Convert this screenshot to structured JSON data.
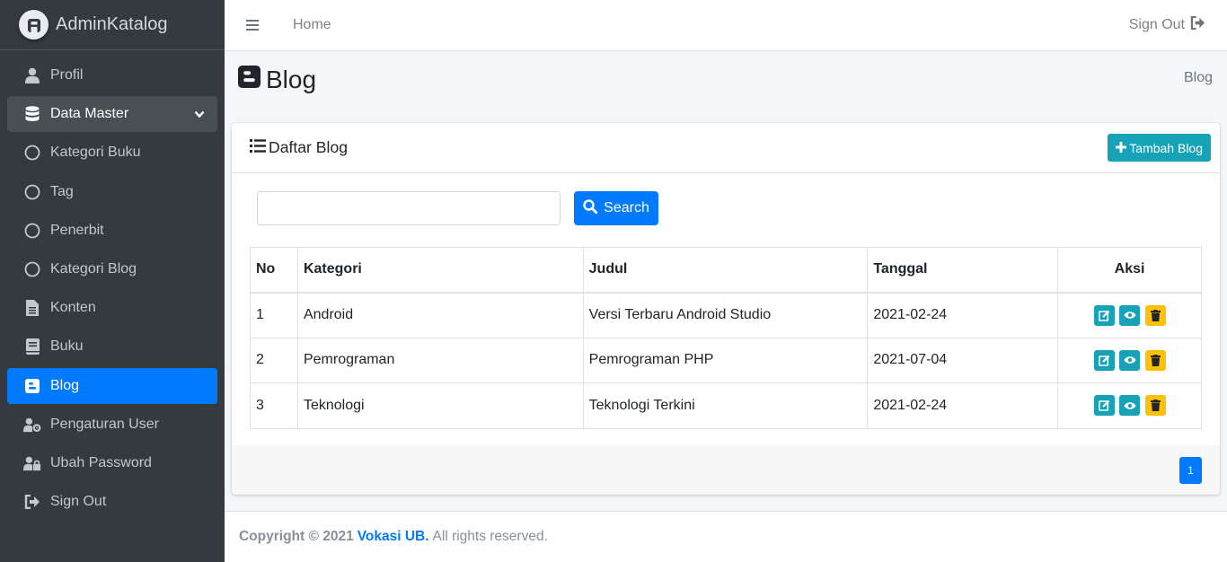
{
  "brand": {
    "name": "AdminKatalog",
    "logo_icon": "brand-logo-icon"
  },
  "sidebar": {
    "items": [
      {
        "label": "Profil",
        "icon": "user-icon"
      },
      {
        "label": "Data Master",
        "icon": "database-icon",
        "state": "open"
      },
      {
        "label": "Kategori Buku",
        "icon": "circle-icon"
      },
      {
        "label": "Tag",
        "icon": "circle-icon"
      },
      {
        "label": "Penerbit",
        "icon": "circle-icon"
      },
      {
        "label": "Kategori Blog",
        "icon": "circle-icon"
      },
      {
        "label": "Konten",
        "icon": "file-icon"
      },
      {
        "label": "Buku",
        "icon": "book-icon"
      },
      {
        "label": "Blog",
        "icon": "blogger-icon",
        "state": "active"
      },
      {
        "label": "Pengaturan User",
        "icon": "user-cog-icon"
      },
      {
        "label": "Ubah Password",
        "icon": "user-lock-icon"
      },
      {
        "label": "Sign Out",
        "icon": "sign-out-icon"
      }
    ]
  },
  "topbar": {
    "home": "Home",
    "signout": "Sign Out"
  },
  "page": {
    "title": "Blog",
    "breadcrumb": "Blog"
  },
  "card": {
    "title": "Daftar Blog",
    "add_button": "Tambah Blog",
    "search": {
      "value": "",
      "placeholder": "",
      "button": "Search"
    }
  },
  "table": {
    "headers": [
      "No",
      "Kategori",
      "Judul",
      "Tanggal",
      "Aksi"
    ],
    "rows": [
      {
        "no": "1",
        "kategori": "Android",
        "judul": "Versi Terbaru Android Studio",
        "tanggal": "2021-02-24"
      },
      {
        "no": "2",
        "kategori": "Pemrograman",
        "judul": "Pemrograman PHP",
        "tanggal": "2021-07-04"
      },
      {
        "no": "3",
        "kategori": "Teknologi",
        "judul": "Teknologi Terkini",
        "tanggal": "2021-02-24"
      }
    ]
  },
  "pagination": {
    "current": "1"
  },
  "footer": {
    "prefix": "Copyright © 2021",
    "link": "Vokasi UB.",
    "suffix": "All rights reserved."
  },
  "colors": {
    "primary": "#007bff",
    "info": "#17a2b8",
    "warning": "#ffc107",
    "sidebar": "#343a40"
  }
}
